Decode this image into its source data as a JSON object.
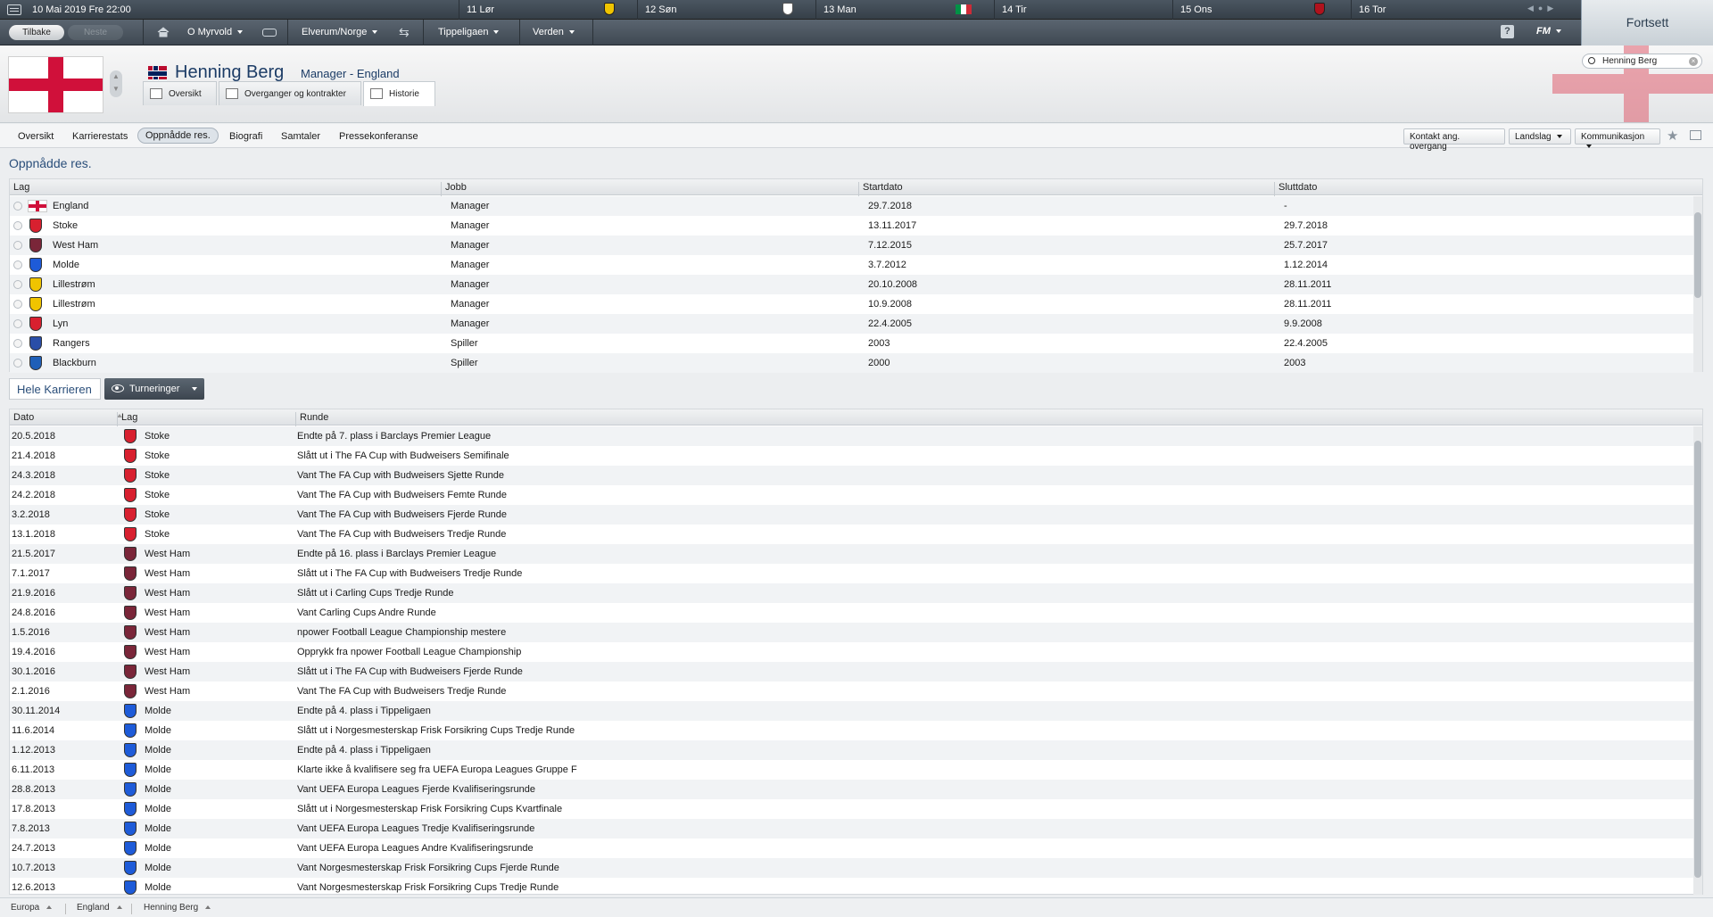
{
  "datebar": {
    "current_date": "10 Mai 2019  Fre  22:00",
    "days": [
      {
        "label": "11 Lør"
      },
      {
        "label": "12 Søn"
      },
      {
        "label": "13 Man"
      },
      {
        "label": "14 Tir"
      },
      {
        "label": "15 Ons"
      },
      {
        "label": "16 Tor"
      }
    ],
    "continue_label": "Fortsett"
  },
  "toolbar": {
    "back": "Tilbake",
    "next": "Neste",
    "menu_club": "O Myrvold",
    "menu_nation": "Elverum/Norge",
    "menu_league": "Tippeligaen",
    "menu_world": "Verden",
    "help": "?",
    "fm": "FM"
  },
  "header": {
    "name": "Henning Berg",
    "role": "Manager - England",
    "tabs": [
      "Oversikt",
      "Overganger og kontrakter",
      "Historie"
    ],
    "search_value": "Henning Berg"
  },
  "subnav": {
    "items": [
      "Oversikt",
      "Karrierestats",
      "Oppnådde res.",
      "Biografi",
      "Samtaler",
      "Pressekonferanse"
    ],
    "buttons": [
      "Kontakt ang. overgang",
      "Landslag",
      "Kommunikasjon"
    ]
  },
  "section1": {
    "title": "Oppnådde res.",
    "columns": [
      "Lag",
      "Jobb",
      "Startdato",
      "Sluttdato"
    ],
    "rows": [
      {
        "team": "England",
        "job": "Manager",
        "start": "29.7.2018",
        "end": "-"
      },
      {
        "team": "Stoke",
        "job": "Manager",
        "start": "13.11.2017",
        "end": "29.7.2018"
      },
      {
        "team": "West Ham",
        "job": "Manager",
        "start": "7.12.2015",
        "end": "25.7.2017"
      },
      {
        "team": "Molde",
        "job": "Manager",
        "start": "3.7.2012",
        "end": "1.12.2014"
      },
      {
        "team": "Lillestrøm",
        "job": "Manager",
        "start": "20.10.2008",
        "end": "28.11.2011"
      },
      {
        "team": "Lillestrøm",
        "job": "Manager",
        "start": "10.9.2008",
        "end": "28.11.2011"
      },
      {
        "team": "Lyn",
        "job": "Manager",
        "start": "22.4.2005",
        "end": "9.9.2008"
      },
      {
        "team": "Rangers",
        "job": "Spiller",
        "start": "2003",
        "end": "22.4.2005"
      },
      {
        "team": "Blackburn",
        "job": "Spiller",
        "start": "2000",
        "end": "2003"
      }
    ]
  },
  "section2": {
    "whole_career": "Hele Karrieren",
    "filter": "Turneringer",
    "columns": [
      "Dato",
      "Lag",
      "Runde"
    ],
    "rows": [
      {
        "date": "20.5.2018",
        "team": "Stoke",
        "round": "Endte på 7. plass i Barclays Premier League"
      },
      {
        "date": "21.4.2018",
        "team": "Stoke",
        "round": "Slått ut i The FA Cup with Budweisers Semifinale"
      },
      {
        "date": "24.3.2018",
        "team": "Stoke",
        "round": "Vant The FA Cup with Budweisers Sjette Runde"
      },
      {
        "date": "24.2.2018",
        "team": "Stoke",
        "round": "Vant The FA Cup with Budweisers Femte Runde"
      },
      {
        "date": "3.2.2018",
        "team": "Stoke",
        "round": "Vant The FA Cup with Budweisers Fjerde Runde"
      },
      {
        "date": "13.1.2018",
        "team": "Stoke",
        "round": "Vant The FA Cup with Budweisers Tredje Runde"
      },
      {
        "date": "21.5.2017",
        "team": "West Ham",
        "round": "Endte på 16. plass i Barclays Premier League"
      },
      {
        "date": "7.1.2017",
        "team": "West Ham",
        "round": "Slått ut i The FA Cup with Budweisers Tredje Runde"
      },
      {
        "date": "21.9.2016",
        "team": "West Ham",
        "round": "Slått ut i Carling Cups Tredje Runde"
      },
      {
        "date": "24.8.2016",
        "team": "West Ham",
        "round": "Vant Carling Cups Andre Runde"
      },
      {
        "date": "1.5.2016",
        "team": "West Ham",
        "round": "npower Football League Championship mestere"
      },
      {
        "date": "19.4.2016",
        "team": "West Ham",
        "round": "Opprykk fra npower Football League Championship"
      },
      {
        "date": "30.1.2016",
        "team": "West Ham",
        "round": "Slått ut i The FA Cup with Budweisers Fjerde Runde"
      },
      {
        "date": "2.1.2016",
        "team": "West Ham",
        "round": "Vant The FA Cup with Budweisers Tredje Runde"
      },
      {
        "date": "30.11.2014",
        "team": "Molde",
        "round": "Endte på 4. plass i Tippeligaen"
      },
      {
        "date": "11.6.2014",
        "team": "Molde",
        "round": "Slått ut i Norgesmesterskap Frisk Forsikring Cups Tredje Runde"
      },
      {
        "date": "1.12.2013",
        "team": "Molde",
        "round": "Endte på 4. plass i Tippeligaen"
      },
      {
        "date": "6.11.2013",
        "team": "Molde",
        "round": "Klarte ikke å kvalifisere seg fra UEFA Europa Leagues Gruppe F"
      },
      {
        "date": "28.8.2013",
        "team": "Molde",
        "round": "Vant UEFA Europa Leagues Fjerde Kvalifiseringsrunde"
      },
      {
        "date": "17.8.2013",
        "team": "Molde",
        "round": "Slått ut i Norgesmesterskap Frisk Forsikring Cups Kvartfinale"
      },
      {
        "date": "7.8.2013",
        "team": "Molde",
        "round": "Vant UEFA Europa Leagues Tredje Kvalifiseringsrunde"
      },
      {
        "date": "24.7.2013",
        "team": "Molde",
        "round": "Vant UEFA Europa Leagues Andre Kvalifiseringsrunde"
      },
      {
        "date": "10.7.2013",
        "team": "Molde",
        "round": "Vant Norgesmesterskap Frisk Forsikring Cups Fjerde Runde"
      },
      {
        "date": "12.6.2013",
        "team": "Molde",
        "round": "Vant Norgesmesterskap Frisk Forsikring Cups Tredje Runde"
      }
    ]
  },
  "footer": {
    "crumbs": [
      "Europa",
      "England",
      "Henning Berg"
    ]
  },
  "crest_colors": {
    "England": "#ffffff",
    "Stoke": "#d8202f",
    "West Ham": "#7a2639",
    "Molde": "#1e5bd8",
    "Lillestrøm": "#f0c400",
    "Lyn": "#d8202f",
    "Rangers": "#2a4ea8",
    "Blackburn": "#1f5fb8"
  }
}
